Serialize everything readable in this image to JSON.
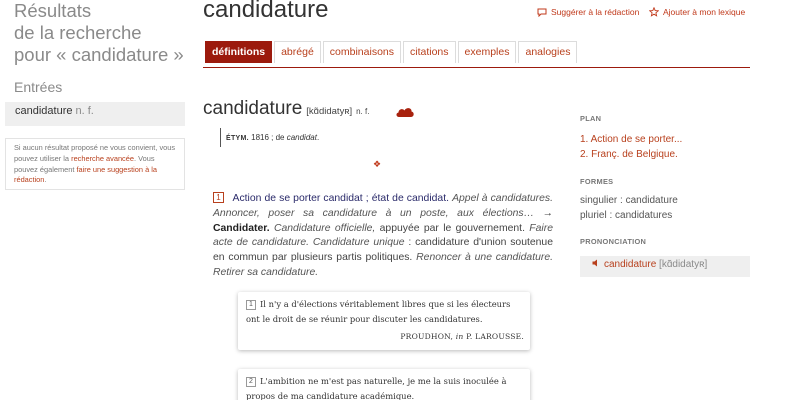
{
  "left": {
    "title_lines": [
      "Résultats",
      "de la recherche",
      "pour « candidature »"
    ],
    "entries_label": "Entrées",
    "entries": [
      {
        "word": "candidature",
        "pos": "n. f."
      }
    ],
    "suggestion": {
      "text1": "Si aucun résultat proposé ne vous convient, vous pouvez utiliser la ",
      "link1": "recherche avancée",
      "text2": ". Vous pouvez également ",
      "link2": "faire une suggestion à la rédaction",
      "text3": "."
    }
  },
  "header": {
    "headword": "candidature",
    "suggest_label": "Suggérer à la rédaction",
    "add_label": "Ajouter à mon lexique"
  },
  "tabs": [
    {
      "label": "définitions",
      "active": true
    },
    {
      "label": "abrégé"
    },
    {
      "label": "combinaisons"
    },
    {
      "label": "citations"
    },
    {
      "label": "exemples"
    },
    {
      "label": "analogies"
    }
  ],
  "article": {
    "word": "candidature",
    "pron": "[kɑ̃didatyʀ]",
    "pos": "n. f.",
    "etym_label": "ÉTYM.",
    "etym_text": " 1816 ; de ",
    "etym_word": "candidat",
    "etym_end": ".",
    "ornament": "❖",
    "def": {
      "num": "1",
      "sense": "Action de se porter candidat ; état de candidat.",
      "ex1": "Appel à candidatures. Annoncer, poser sa candidature à un poste, aux élections…",
      "arrow": " → ",
      "ref": "Candidater.",
      "ex2": "Candidature officielle,",
      "t2": " appuyée par le gouvernement. ",
      "ex3": "Faire acte de candidature. Candidature unique",
      "t3": " : candidature d'union soutenue en commun par plusieurs partis politiques. ",
      "ex4": "Renoncer à une candidature. Retirer sa candidature."
    },
    "citations": [
      {
        "num": "1",
        "text": "Il n'y a d'élections véritablement libres que si les électeurs ont le droit de se réunir pour discuter les candidatures.",
        "author": "PROUDHON,",
        "in": "in",
        "source": "P. LAROUSSE."
      },
      {
        "num": "2",
        "text": "L'ambition ne m'est pas naturelle, je me la suis inoculée à propos de ma candidature académique."
      }
    ]
  },
  "sidebar": {
    "plan_label": "PLAN",
    "plan_items": [
      "1. Action de se porter...",
      "2. Franç. de Belgique."
    ],
    "formes_label": "FORMES",
    "formes": [
      "singulier : candidature",
      "pluriel : candidatures"
    ],
    "pron_label": "PRONONCIATION",
    "pron_word": "candidature",
    "pron_phon": "[kɑ̃didatyʀ]"
  },
  "colors": {
    "accent": "#9c1a0d",
    "link": "#b8401d"
  }
}
